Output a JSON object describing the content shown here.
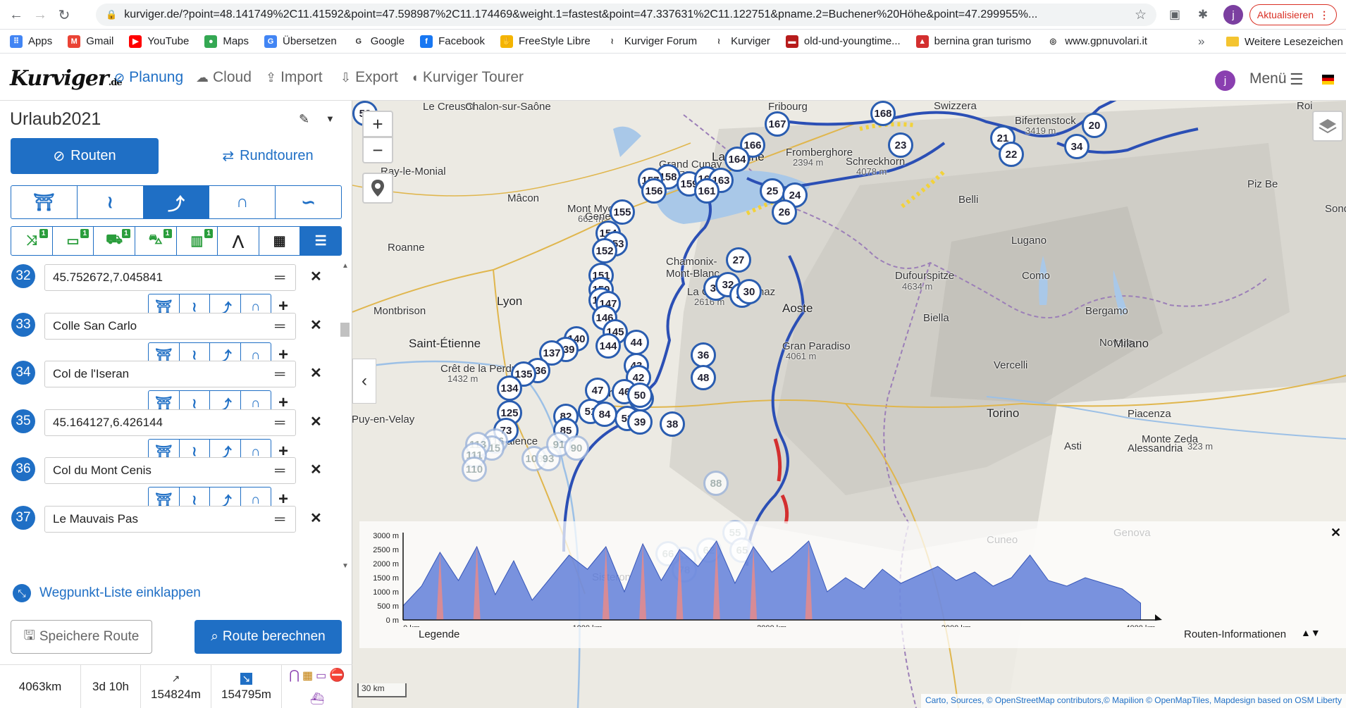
{
  "browser": {
    "url": "kurviger.de/?point=48.141749%2C11.41592&point=47.598987%2C11.174469&weight.1=fastest&point=47.337631%2C11.122751&pname.2=Buchener%20Höhe&point=47.299955%...",
    "update_label": "Aktualisieren"
  },
  "bookmarks": {
    "items": [
      {
        "label": "Apps",
        "color": "#4285f4",
        "glyph": "⠿"
      },
      {
        "label": "Gmail",
        "color": "#ea4335",
        "glyph": "M"
      },
      {
        "label": "YouTube",
        "color": "#ff0000",
        "glyph": "▶"
      },
      {
        "label": "Maps",
        "color": "#34a853",
        "glyph": "●"
      },
      {
        "label": "Übersetzen",
        "color": "#4285f4",
        "glyph": "G"
      },
      {
        "label": "Google",
        "color": "#ffffff",
        "glyph": "G"
      },
      {
        "label": "Facebook",
        "color": "#1877f2",
        "glyph": "f"
      },
      {
        "label": "FreeStyle Libre",
        "color": "#f4b400",
        "glyph": "✋"
      },
      {
        "label": "Kurviger Forum",
        "color": "#ffffff",
        "glyph": "≀"
      },
      {
        "label": "Kurviger",
        "color": "#ffffff",
        "glyph": "≀"
      },
      {
        "label": "old-und-youngtime...",
        "color": "#b71c1c",
        "glyph": "▬"
      },
      {
        "label": "bernina gran turismo",
        "color": "#d32f2f",
        "glyph": "▲"
      },
      {
        "label": "www.gpnuvolari.it",
        "color": "#ffffff",
        "glyph": "◎"
      }
    ],
    "more": "»",
    "other_label": "Weitere Lesezeichen"
  },
  "header": {
    "logo": "Kurviger",
    "logo_tld": ".de",
    "nav": [
      {
        "label": "Planung",
        "icon": "compass-icon"
      },
      {
        "label": "Cloud",
        "icon": "cloud-icon"
      },
      {
        "label": "Import",
        "icon": "upload-icon"
      },
      {
        "label": "Export",
        "icon": "download-icon"
      },
      {
        "label": "Kurviger Tourer",
        "icon": "tourer-icon"
      }
    ],
    "user_initial": "j",
    "menu_label": "Menü"
  },
  "sidebar": {
    "route_name": "Urlaub2021",
    "tab_routes": "Routen",
    "tab_roundtrips": "Rundtouren",
    "waypoints": [
      {
        "num": "32",
        "value": "45.752672,7.045841"
      },
      {
        "num": "33",
        "value": "Colle San Carlo"
      },
      {
        "num": "34",
        "value": "Col de l'Iseran"
      },
      {
        "num": "35",
        "value": "45.164127,6.426144"
      },
      {
        "num": "36",
        "value": "Col du Mont Cenis"
      },
      {
        "num": "37",
        "value": "Le Mauvais Pas"
      }
    ],
    "option_badges": [
      "1",
      "1",
      "1",
      "1",
      "1"
    ],
    "collapse_label": "Wegpunkt-Liste einklappen",
    "save_label": "Speichere Route",
    "calc_label": "Route berechnen",
    "stats": {
      "distance": "4063km",
      "duration": "3d 10h",
      "ascent": "154824m",
      "descent": "154795m"
    }
  },
  "map": {
    "places": [
      {
        "name": "Le Creusot"
      },
      {
        "name": "Chalon-sur-Saône"
      },
      {
        "name": "Fribourg"
      },
      {
        "name": "Lausanne"
      },
      {
        "name": "Grand Cunay"
      },
      {
        "name": "1570 m"
      },
      {
        "name": "Fromberghore"
      },
      {
        "name": "2394 m"
      },
      {
        "name": "Schreckhorn"
      },
      {
        "name": "4078 m"
      },
      {
        "name": "Bifertenstock"
      },
      {
        "name": "3419 m"
      },
      {
        "name": "Ray-le-Monial"
      },
      {
        "name": "Mâcon"
      },
      {
        "name": "Mont Myon"
      },
      {
        "name": "662 m"
      },
      {
        "name": "Gene"
      },
      {
        "name": "Roanne"
      },
      {
        "name": "Chamonix-"
      },
      {
        "name": "Mont-Blanc"
      },
      {
        "name": "La Grande Balmaz"
      },
      {
        "name": "2616 m"
      },
      {
        "name": "Lyon"
      },
      {
        "name": "Aoste"
      },
      {
        "name": "Dufourspitze"
      },
      {
        "name": "4634 m"
      },
      {
        "name": "Lugano"
      },
      {
        "name": "Como"
      },
      {
        "name": "Bergamo"
      },
      {
        "name": "Montbrison"
      },
      {
        "name": "Saint-Étienne"
      },
      {
        "name": "Biella"
      },
      {
        "name": "Gran Paradiso"
      },
      {
        "name": "4061 m"
      },
      {
        "name": "Novara"
      },
      {
        "name": "Milano"
      },
      {
        "name": "Crêt de la Perdrix"
      },
      {
        "name": "1432 m"
      },
      {
        "name": "Grenoble"
      },
      {
        "name": "Vercelli"
      },
      {
        "name": "Puy-en-Velay"
      },
      {
        "name": "Torino"
      },
      {
        "name": "Piacenza"
      },
      {
        "name": "Valence"
      },
      {
        "name": "Asti"
      },
      {
        "name": "Alessandria"
      },
      {
        "name": "Cuneo"
      },
      {
        "name": "Sisteron"
      },
      {
        "name": "Belli"
      },
      {
        "name": "Piz Be"
      },
      {
        "name": "Sondr"
      },
      {
        "name": "Genova"
      },
      {
        "name": "Monte Zeda"
      },
      {
        "name": "323 m"
      },
      {
        "name": "Roi"
      },
      {
        "name": "Swizzera"
      }
    ],
    "markers": [
      "167",
      "168",
      "166",
      "164",
      "23",
      "21",
      "22",
      "20",
      "34",
      "158",
      "157",
      "159",
      "162",
      "163",
      "156",
      "161",
      "25",
      "24",
      "26",
      "155",
      "154",
      "153",
      "152",
      "151",
      "150",
      "149",
      "147",
      "146",
      "145",
      "144",
      "140",
      "139",
      "137",
      "136",
      "135",
      "134",
      "27",
      "33",
      "32",
      "31",
      "30",
      "44",
      "43",
      "42",
      "34",
      "36",
      "48",
      "47",
      "46",
      "52",
      "50",
      "51",
      "84",
      "82",
      "85",
      "39",
      "38",
      "125",
      "73",
      "116",
      "115",
      "113",
      "111",
      "110",
      "108",
      "93",
      "91",
      "90",
      "88",
      "55",
      "62",
      "65",
      "81",
      "78",
      "66",
      "53"
    ],
    "scale": "30 km",
    "attribution": "Carto, Sources, © OpenStreetMap contributors,© Mapilion © OpenMapTiles, Mapdesign based on OSM Liberty"
  },
  "elevation": {
    "y_ticks": [
      "3000 m",
      "2500 m",
      "2000 m",
      "1500 m",
      "1000 m",
      "500 m",
      "0 m"
    ],
    "x_ticks": [
      "0 km",
      "1000 km",
      "2000 km",
      "3000 km",
      "4000 km"
    ],
    "legend_label": "Legende",
    "route_info_label": "Routen-Informationen"
  },
  "chart_data": {
    "type": "area",
    "xlabel": "",
    "ylabel": "",
    "xlim": [
      0,
      4063
    ],
    "ylim": [
      0,
      3000
    ],
    "x": [
      0,
      100,
      200,
      300,
      400,
      500,
      600,
      700,
      800,
      900,
      1000,
      1100,
      1200,
      1300,
      1400,
      1500,
      1600,
      1700,
      1800,
      1900,
      2000,
      2100,
      2200,
      2300,
      2400,
      2500,
      2600,
      2700,
      2800,
      2900,
      3000,
      3100,
      3200,
      3300,
      3400,
      3500,
      3600,
      3700,
      3800,
      3900,
      4000
    ],
    "series": [
      {
        "values": [
          500,
          1200,
          2400,
          1400,
          2600,
          900,
          2100,
          700,
          1500,
          2300,
          1800,
          2600,
          1000,
          2700,
          1400,
          2500,
          1900,
          2800,
          1300,
          2600,
          1700,
          2200,
          2800,
          1000,
          1500,
          1100,
          1800,
          1300,
          1600,
          1900,
          1400,
          1700,
          1200,
          1500,
          2300,
          1400,
          1200,
          1500,
          1300,
          1100,
          600
        ]
      }
    ],
    "colors": {
      "fill": "#4d6fd6",
      "peak": "#e88a8a"
    }
  }
}
